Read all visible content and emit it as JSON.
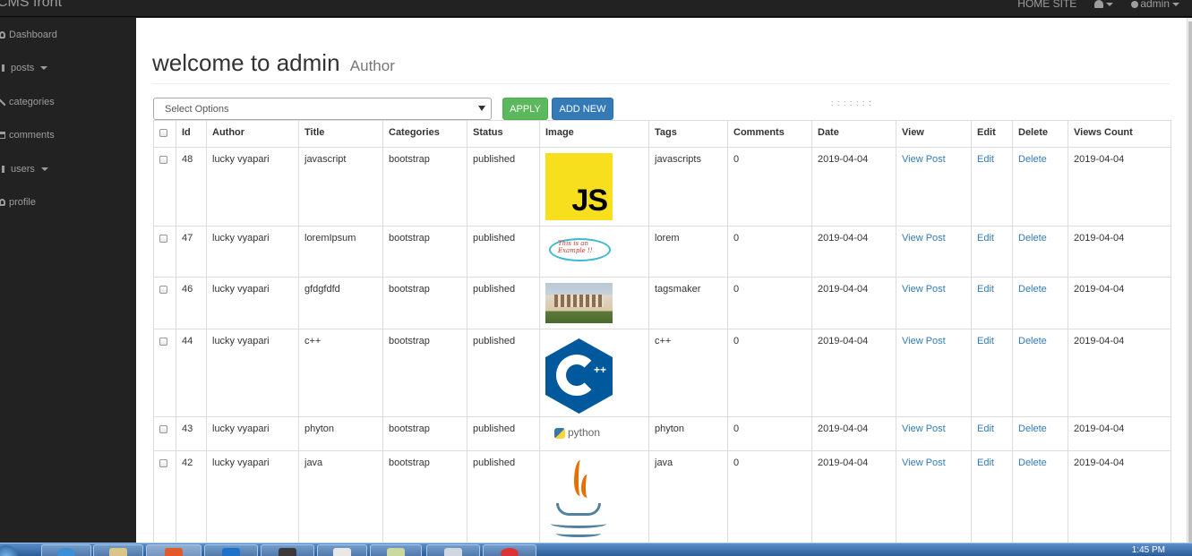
{
  "navbar": {
    "brand": "CMS front",
    "home_site": "HOME SITE",
    "user": "admin"
  },
  "sidebar": {
    "items": [
      {
        "label": "Dashboard"
      },
      {
        "label": "posts"
      },
      {
        "label": "categories"
      },
      {
        "label": "comments"
      },
      {
        "label": "users"
      },
      {
        "label": "profile"
      }
    ]
  },
  "header": {
    "title": "welcome to admin",
    "subtitle": "Author"
  },
  "toolbar": {
    "select_value": "Select Options",
    "apply_label": "APPLY",
    "add_label": "ADD NEW",
    "dots": ": : : : : : :"
  },
  "table": {
    "columns": [
      "Id",
      "Author",
      "Title",
      "Categories",
      "Status",
      "Image",
      "Tags",
      "Comments",
      "Date",
      "View",
      "Edit",
      "Delete",
      "Views Count"
    ],
    "rows": [
      {
        "id": "48",
        "author": "lucky vyapari",
        "title": "javascript",
        "category": "bootstrap",
        "status": "published",
        "image": "js-logo",
        "tags": "javascripts",
        "comments": "0",
        "date": "2019-04-04",
        "view": "View Post",
        "edit": "Edit",
        "delete": "Delete",
        "views_count": "2019-04-04"
      },
      {
        "id": "47",
        "author": "lucky vyapari",
        "title": "loremIpsum",
        "category": "bootstrap",
        "status": "published",
        "image": "handwritten-example",
        "tags": "lorem",
        "comments": "0",
        "date": "2019-04-04",
        "view": "View Post",
        "edit": "Edit",
        "delete": "Delete",
        "views_count": "2019-04-04"
      },
      {
        "id": "46",
        "author": "lucky vyapari",
        "title": "gfdgfdfd",
        "category": "bootstrap",
        "status": "published",
        "image": "building-photo",
        "tags": "tagsmaker",
        "comments": "0",
        "date": "2019-04-04",
        "view": "View Post",
        "edit": "Edit",
        "delete": "Delete",
        "views_count": "2019-04-04"
      },
      {
        "id": "44",
        "author": "lucky vyapari",
        "title": "c++",
        "category": "bootstrap",
        "status": "published",
        "image": "cpp-logo",
        "tags": "c++",
        "comments": "0",
        "date": "2019-04-04",
        "view": "View Post",
        "edit": "Edit",
        "delete": "Delete",
        "views_count": "2019-04-04"
      },
      {
        "id": "43",
        "author": "lucky vyapari",
        "title": "phyton",
        "category": "bootstrap",
        "status": "published",
        "image": "python-logo",
        "tags": "phyton",
        "comments": "0",
        "date": "2019-04-04",
        "view": "View Post",
        "edit": "Edit",
        "delete": "Delete",
        "views_count": "2019-04-04"
      },
      {
        "id": "42",
        "author": "lucky vyapari",
        "title": "java",
        "category": "bootstrap",
        "status": "published",
        "image": "java-logo",
        "tags": "java",
        "comments": "0",
        "date": "2019-04-04",
        "view": "View Post",
        "edit": "Edit",
        "delete": "Delete",
        "views_count": "2019-04-04"
      }
    ],
    "image_text": {
      "js": "JS",
      "lorem": "This is an Example !!",
      "cpp": "++",
      "python": "python"
    }
  },
  "taskbar": {
    "clock": "1:45 PM"
  },
  "colors": {
    "sidebar_bg": "#222222",
    "link": "#337ab7",
    "apply": "#5cb85c",
    "add_new": "#337ab7"
  }
}
